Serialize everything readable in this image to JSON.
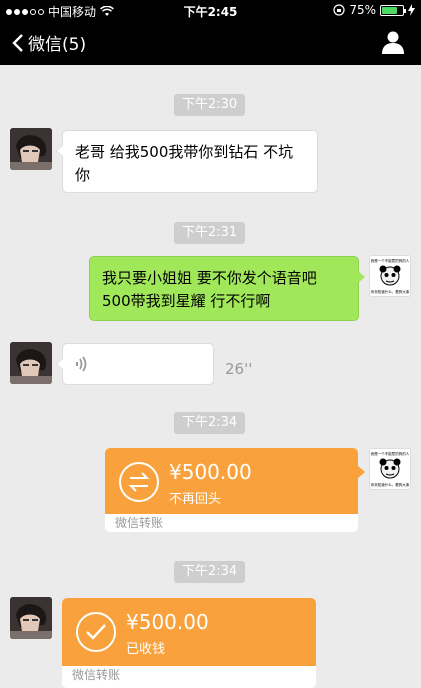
{
  "status_bar": {
    "carrier": "中国移动",
    "time": "下午2:45",
    "battery": "75%",
    "battery_level": 0.75
  },
  "nav": {
    "back_label": "微信(5)"
  },
  "messages": [
    {
      "time": "下午2:30",
      "text": "老哥 给我500我带你到钻石 不坑你"
    },
    {
      "time": "下午2:31",
      "text": "我只要小姐姐 要不你发个语音吧 500带我到星耀 行不行啊"
    },
    {
      "voice_duration": "26''"
    },
    {
      "time": "下午2:34",
      "amount": "¥500.00",
      "sub": "不再回头",
      "footer": "微信转账"
    },
    {
      "time": "下午2:34",
      "amount": "¥500.00",
      "sub": "已收钱",
      "footer": "微信转账"
    }
  ],
  "meme_text": {
    "top": "我是一个不能惹的狗的人",
    "bottom": "你未知道什么，看狗大事"
  },
  "colors": {
    "nav_bg": "#000000",
    "chat_bg": "#ebebeb",
    "green_bubble": "#a0e75a",
    "transfer_orange": "#f9a13c"
  }
}
